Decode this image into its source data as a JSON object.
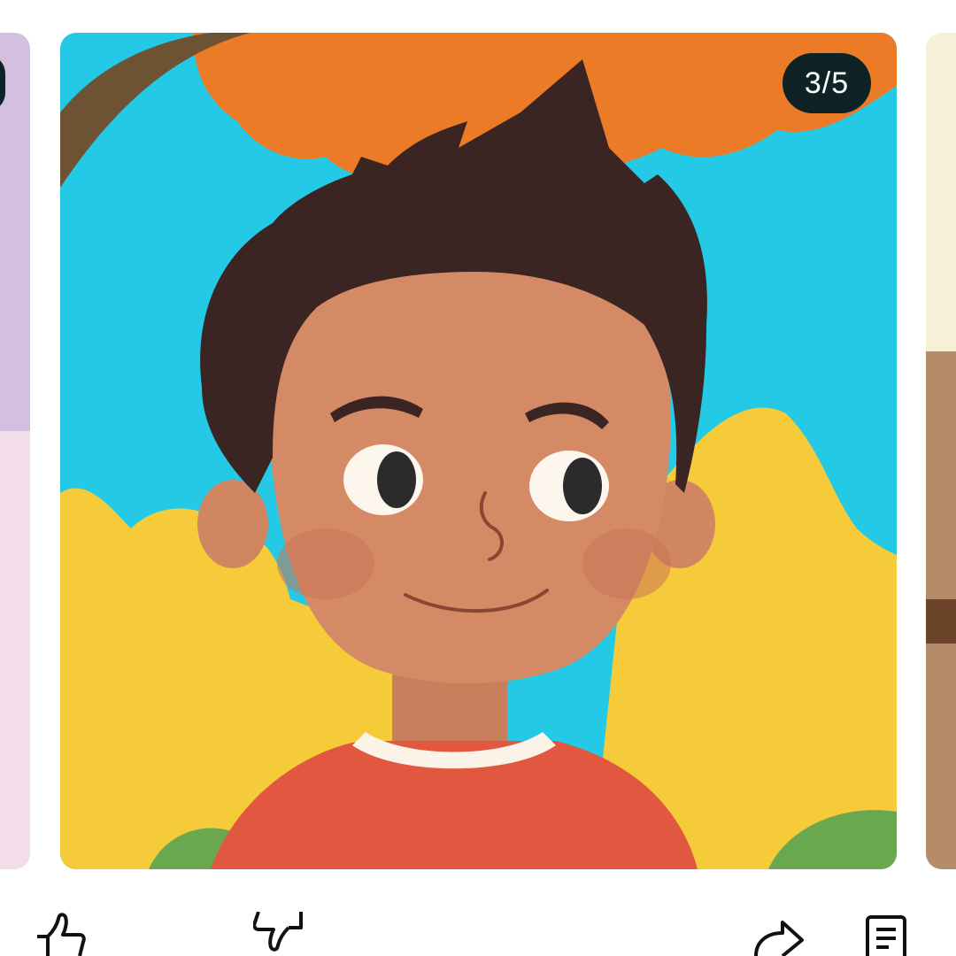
{
  "post": {
    "counter": "3/5",
    "current_index": 3,
    "total_images": 5
  },
  "actions": {
    "like_icon": "thumbs-up-icon",
    "dislike_icon": "thumbs-down-icon",
    "share_icon": "share-arrow-icon",
    "comments_icon": "comments-icon"
  },
  "colors": {
    "badge_background": "#0f2226",
    "badge_text": "#ffffff",
    "sky": "#24c9e6",
    "tree_orange": "#ec7b28",
    "bush_yellow": "#f6cb3a",
    "skin": "#d48a64",
    "hair": "#3a2522",
    "shirt": "#e2573f"
  }
}
